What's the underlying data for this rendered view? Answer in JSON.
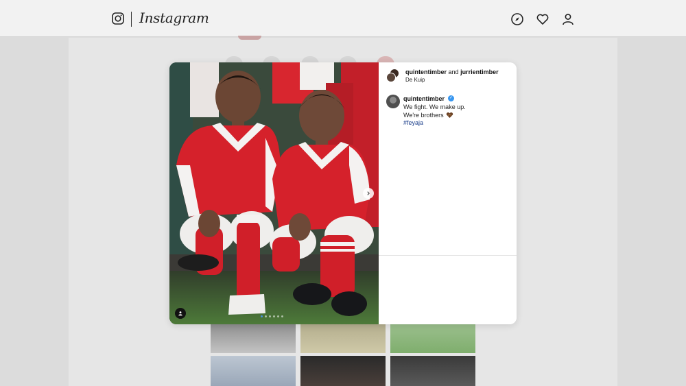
{
  "app": {
    "name": "Instagram"
  },
  "nav": {
    "icons": [
      "instagram-logo-icon",
      "compass-icon",
      "heart-icon",
      "profile-icon"
    ]
  },
  "post": {
    "header": {
      "user_primary": "quintentimber",
      "joiner": "and",
      "user_secondary": "jurrientimber",
      "location": "De Kuip"
    },
    "caption": {
      "username": "quintentimber",
      "verified": true,
      "lines": [
        "We fight. We make up.",
        "We're brothers"
      ],
      "emoji": "handshake-heart-emoji",
      "hashtag": "#feyaja"
    },
    "carousel": {
      "slide_count": 6,
      "active_index": 0
    }
  },
  "colors": {
    "link": "#1c3f8b",
    "verified": "#3897f0",
    "carousel_active": "#4a90e2"
  }
}
